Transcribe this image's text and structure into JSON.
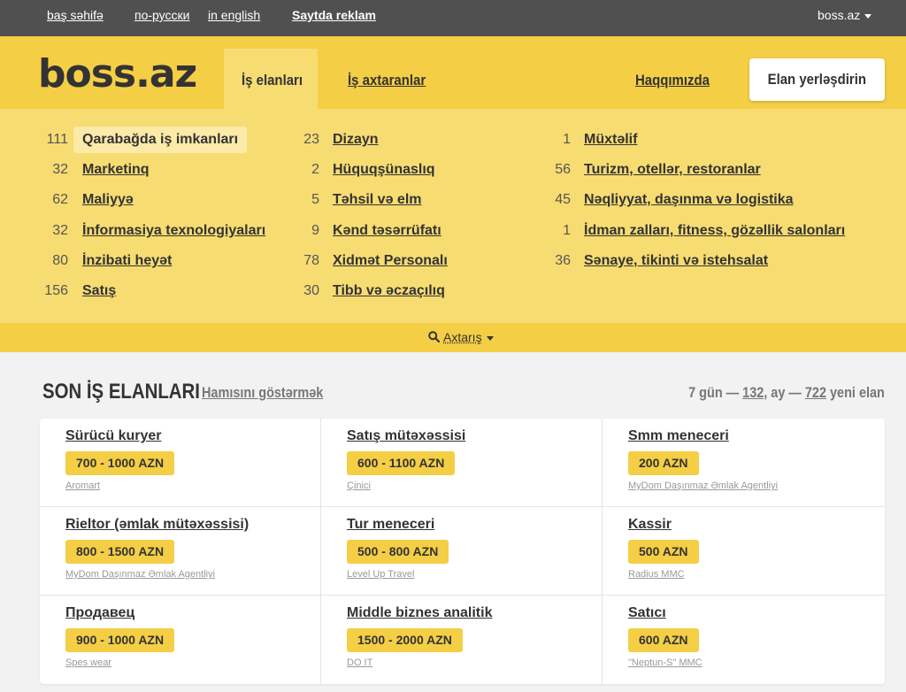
{
  "topbar": {
    "home": "baş səhifə",
    "russian": "по-русски",
    "english": "in english",
    "ads": "Saytda reklam",
    "site": "boss.az"
  },
  "header": {
    "logo": "boss.az",
    "tab_jobs": "İş elanları",
    "tab_seekers": "İş axtaranlar",
    "about": "Haqqımızda",
    "post_button": "Elan yerləşdirin",
    "accent_color": "#f4ce45"
  },
  "categories": [
    {
      "count": "111",
      "name": "Qarabağda iş imkanları"
    },
    {
      "count": "32",
      "name": "Marketinq"
    },
    {
      "count": "62",
      "name": "Maliyyə"
    },
    {
      "count": "32",
      "name": "İnformasiya texnologiyaları"
    },
    {
      "count": "80",
      "name": "İnzibati heyət"
    },
    {
      "count": "156",
      "name": "Satış"
    },
    {
      "count": "23",
      "name": "Dizayn"
    },
    {
      "count": "2",
      "name": "Hüquqşünaslıq"
    },
    {
      "count": "5",
      "name": "Təhsil və elm"
    },
    {
      "count": "9",
      "name": "Kənd təsərrüfatı"
    },
    {
      "count": "78",
      "name": "Xidmət Personalı"
    },
    {
      "count": "30",
      "name": "Tibb və əczaçılıq"
    },
    {
      "count": "1",
      "name": "Müxtəlif"
    },
    {
      "count": "56",
      "name": "Turizm, otellər, restoranlar"
    },
    {
      "count": "45",
      "name": "Nəqliyyat, daşınma və logistika"
    },
    {
      "count": "1",
      "name": "İdman zalları, fitness, gözəllik salonları"
    },
    {
      "count": "36",
      "name": "Sənaye, tikinti və istehsalat"
    }
  ],
  "search": {
    "label": "Axtarış",
    "icon": "search-icon"
  },
  "latest": {
    "title": "SON İŞ ELANLARI",
    "show_all": "Hamısını göstərmək",
    "stats_prefix": "7 gün —",
    "week_count": "132",
    "stats_mid": ", ay —",
    "month_count": "722",
    "stats_suffix": "yeni elan"
  },
  "jobs": [
    {
      "title": "Sürücü kuryer",
      "salary": "700 - 1000 AZN",
      "company": "Aromart"
    },
    {
      "title": "Satış mütəxəssisi",
      "salary": "600 - 1100 AZN",
      "company": "Çinici"
    },
    {
      "title": "Smm meneceri",
      "salary": "200 AZN",
      "company": "MyDom Daşınmaz Əmlak Agentliyi"
    },
    {
      "title": "Rieltor (əmlak mütəxəssisi)",
      "salary": "800 - 1500 AZN",
      "company": "MyDom Daşınmaz Əmlak Agentliyi"
    },
    {
      "title": "Tur meneceri",
      "salary": "500 - 800 AZN",
      "company": "Level Up Travel"
    },
    {
      "title": "Kassir",
      "salary": "500 AZN",
      "company": "Radius MMC"
    },
    {
      "title": "Продавец",
      "salary": "900 - 1000 AZN",
      "company": "Spes wear"
    },
    {
      "title": "Middle biznes analitik",
      "salary": "1500 - 2000 AZN",
      "company": "DO IT"
    },
    {
      "title": "Satıcı",
      "salary": "600 AZN",
      "company": "\"Neptun-S\" MMC"
    }
  ]
}
